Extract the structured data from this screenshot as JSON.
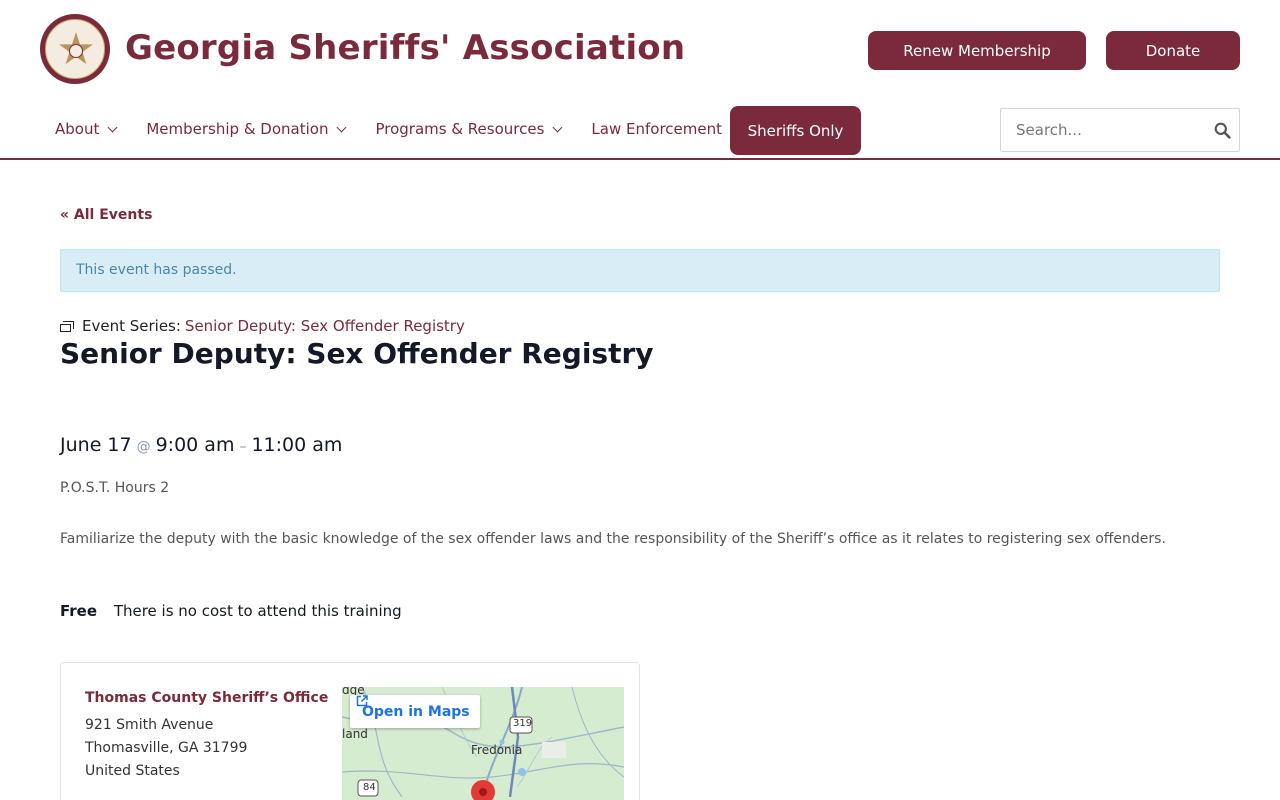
{
  "header": {
    "site_title": "Georgia Sheriffs' Association",
    "renew_label": "Renew Membership",
    "donate_label": "Donate",
    "logo_icon": "star-badge-icon"
  },
  "nav": {
    "items": [
      {
        "label": "About"
      },
      {
        "label": "Membership & Donation"
      },
      {
        "label": "Programs & Resources"
      },
      {
        "label": "Law Enforcement"
      }
    ],
    "sheriffs_only_label": "Sheriffs Only"
  },
  "search": {
    "placeholder": "Search..."
  },
  "content": {
    "back_link": "« All Events",
    "notice": "This event has passed.",
    "series_prefix": "Event Series:",
    "series_name": "Senior Deputy: Sex Offender Registry",
    "title": "Senior Deputy: Sex Offender Registry",
    "date": "June 17",
    "at": "@",
    "start_time": "9:00 am",
    "dash": "–",
    "end_time": "11:00 am",
    "hours": "P.O.S.T. Hours 2",
    "description": "Familiarize the deputy with the basic knowledge of the sex offender laws and the responsibility of the Sheriff’s office as it relates to registering sex offenders.",
    "cost_label": "Free",
    "cost_text": "There is no cost to attend this training"
  },
  "venue": {
    "name": "Thomas County Sheriff’s Office",
    "street": "921 Smith Avenue",
    "city_line": "Thomasville, GA 31799",
    "country": "United States",
    "map_open_label": "Open in Maps",
    "map_labels": {
      "town": "Fredonia",
      "edge_top": "dge",
      "edge_left": "land",
      "route_319": "319",
      "route_84": "84"
    }
  },
  "colors": {
    "brand": "#7a2a3a",
    "notice_bg": "#d9edf7",
    "notice_text": "#4a87a8",
    "map_link": "#1a73e8"
  }
}
